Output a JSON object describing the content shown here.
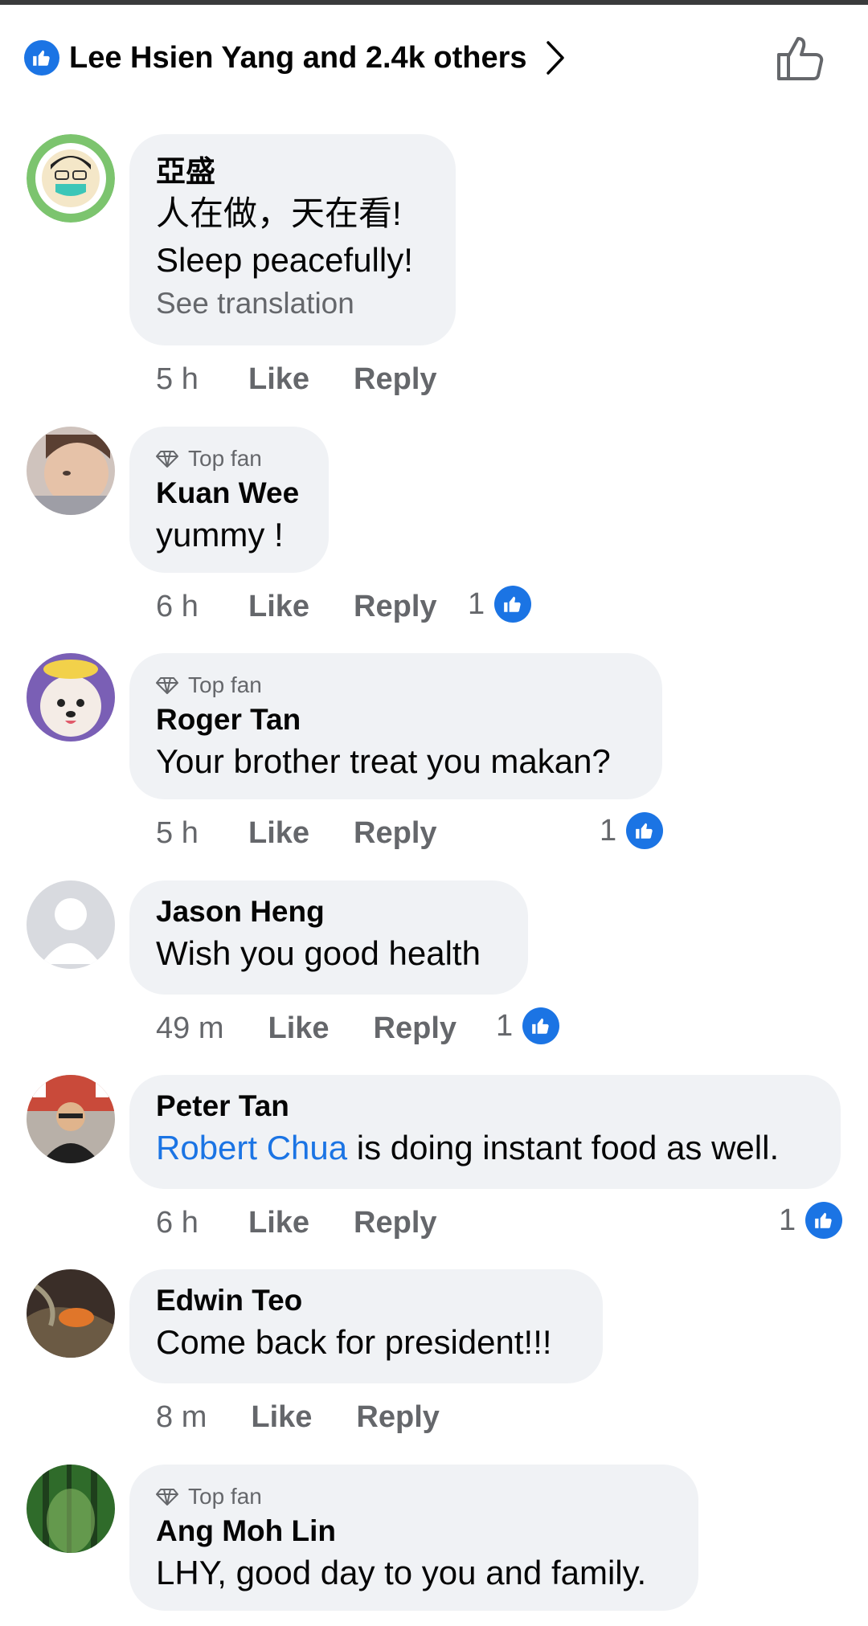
{
  "reactions": {
    "summary": "Lee Hsien Yang and 2.4k others"
  },
  "colors": {
    "accent": "#1b74e4",
    "bubble": "#f0f2f5",
    "muted": "#65676b"
  },
  "labels": {
    "like": "Like",
    "reply": "Reply",
    "top_fan": "Top fan",
    "see_translation": "See translation"
  },
  "comments": [
    {
      "name": "亞盛",
      "lines": [
        "人在做，天在看!",
        "Sleep peacefully!"
      ],
      "time": "5 h",
      "likes": ""
    },
    {
      "name": "Kuan Wee",
      "top_fan": true,
      "lines": [
        "yummy !"
      ],
      "time": "6 h",
      "likes": "1"
    },
    {
      "name": "Roger Tan",
      "top_fan": true,
      "lines": [
        "Your brother treat you makan?"
      ],
      "time": "5 h",
      "likes": "1"
    },
    {
      "name": "Jason Heng",
      "lines": [
        "Wish you good health"
      ],
      "time": "49 m",
      "likes": "1"
    },
    {
      "name": "Peter Tan",
      "mention": "Robert Chua",
      "lines": [
        " is doing instant food as well."
      ],
      "time": "6 h",
      "likes": "1"
    },
    {
      "name": "Edwin Teo",
      "lines": [
        "Come back for president!!!"
      ],
      "time": "8 m",
      "likes": ""
    },
    {
      "name": "Ang Moh Lin",
      "top_fan": true,
      "lines": [
        "LHY, good day to you and family."
      ],
      "time": "",
      "likes": ""
    }
  ]
}
